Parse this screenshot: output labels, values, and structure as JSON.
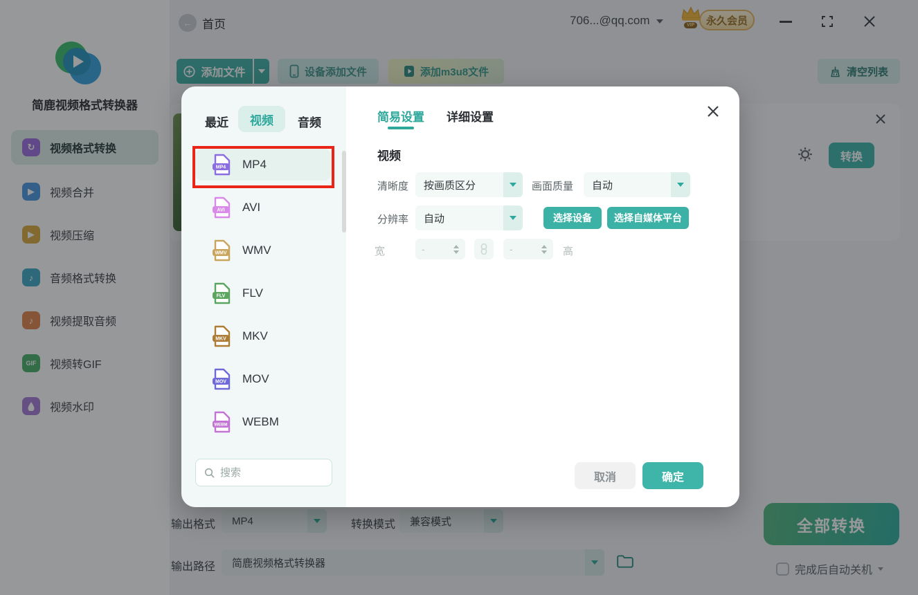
{
  "titlebar": {
    "home": "首页",
    "account": "706...@qq.com",
    "vip_text": "永久会员",
    "vip_tag": "VIP"
  },
  "sidebar": {
    "app_name": "简鹿视频格式转换器",
    "items": [
      {
        "label": "视频格式转换"
      },
      {
        "label": "视频合并"
      },
      {
        "label": "视频压缩"
      },
      {
        "label": "音频格式转换"
      },
      {
        "label": "视频提取音频"
      },
      {
        "label": "视频转GIF"
      },
      {
        "label": "视频水印"
      }
    ]
  },
  "toolbar": {
    "add_file": "添加文件",
    "add_from_device": "设备添加文件",
    "add_m3u8": "添加m3u8文件",
    "clear_list": "清空列表"
  },
  "file_row": {
    "convert": "转换"
  },
  "output": {
    "format_label": "输出格式",
    "format_value": "MP4",
    "mode_label": "转换模式",
    "mode_value": "兼容模式",
    "path_label": "输出路径",
    "path_value": "简鹿视频格式转换器",
    "convert_all": "全部转换",
    "shutdown": "完成后自动关机"
  },
  "modal": {
    "tabs": {
      "recent": "最近",
      "video": "视频",
      "audio": "音频"
    },
    "formats": [
      {
        "name": "MP4",
        "color": "#8a6de0"
      },
      {
        "name": "AVI",
        "color": "#d98ae8"
      },
      {
        "name": "WMV",
        "color": "#c8a45c"
      },
      {
        "name": "FLV",
        "color": "#5ba561"
      },
      {
        "name": "MKV",
        "color": "#ad7c35"
      },
      {
        "name": "MOV",
        "color": "#6f6ad8"
      },
      {
        "name": "WEBM",
        "color": "#c273d4"
      }
    ],
    "search_placeholder": "搜索",
    "settings_tabs": {
      "simple": "简易设置",
      "detailed": "详细设置"
    },
    "video_section": "视频",
    "fields": {
      "clarity_label": "清晰度",
      "clarity_value": "按画质区分",
      "quality_label": "画面质量",
      "quality_value": "自动",
      "resolution_label": "分辨率",
      "resolution_value": "自动",
      "width_label": "宽",
      "height_label": "高",
      "width_value": "-",
      "height_value": "-"
    },
    "actions": {
      "select_device": "选择设备",
      "select_platform": "选择自媒体平台",
      "cancel": "取消",
      "confirm": "确定"
    }
  },
  "colors": {
    "primary": "#3fb5aa",
    "primary_dark": "#2fa89c",
    "annotation_red": "#ea2517",
    "convert_all_gradient": [
      "#53b77d",
      "#2fb0a0"
    ],
    "vip_gold": "#9c7426",
    "sidebar_icons": [
      "#9d6ede",
      "#4a97e0",
      "#d9a93c",
      "#3fa9c6",
      "#e0854e",
      "#47b168",
      "#a77bd4"
    ]
  }
}
